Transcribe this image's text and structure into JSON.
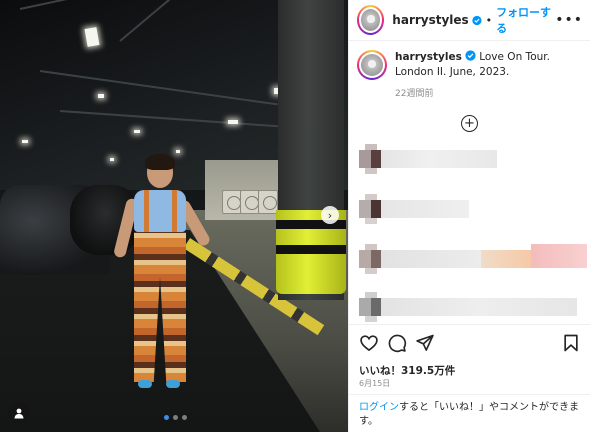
{
  "post": {
    "username": "harrystyles",
    "separator": "•",
    "follow_label": "フォローする",
    "more_label": "•••",
    "caption_username": "harrystyles",
    "caption_text": "Love On Tour. London II. June, 2023.",
    "time_ago": "22週間前",
    "add_icon_label": "+",
    "likes": "いいね！319.5万件",
    "date": "6月15日",
    "login_link": "ログイン",
    "login_text": "すると「いいね！」やコメントができます。"
  },
  "media": {
    "next_arrow": "›",
    "dots": 3,
    "active_dot": 0
  },
  "icons": {
    "verified": "verified-badge-icon",
    "like": "heart-icon",
    "comment": "comment-icon",
    "share": "share-icon",
    "save": "bookmark-icon",
    "tag": "user-tag-icon"
  },
  "colors": {
    "accent": "#0095f6",
    "text": "#262626",
    "muted": "#8e8e8e"
  }
}
